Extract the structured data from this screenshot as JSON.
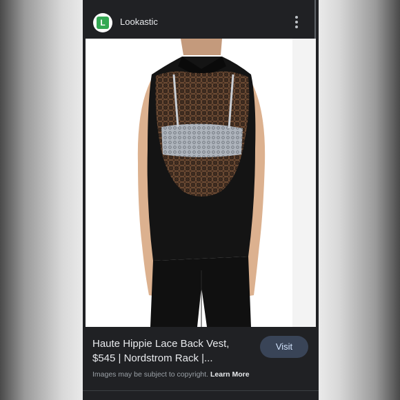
{
  "header": {
    "logo_letter": "L",
    "source_name": "Lookastic",
    "menu_icon": "more-vert-icon"
  },
  "image": {
    "subject": "product-photo"
  },
  "result": {
    "title": "Haute Hippie Lace Back Vest, $545 | Nordstrom Rack |...",
    "visit_label": "Visit",
    "copyright_text": "Images may be subject to copyright.",
    "learn_more_label": "Learn More"
  },
  "colors": {
    "background": "#202124",
    "logo_green": "#34a853",
    "visit_button": "#394457"
  }
}
